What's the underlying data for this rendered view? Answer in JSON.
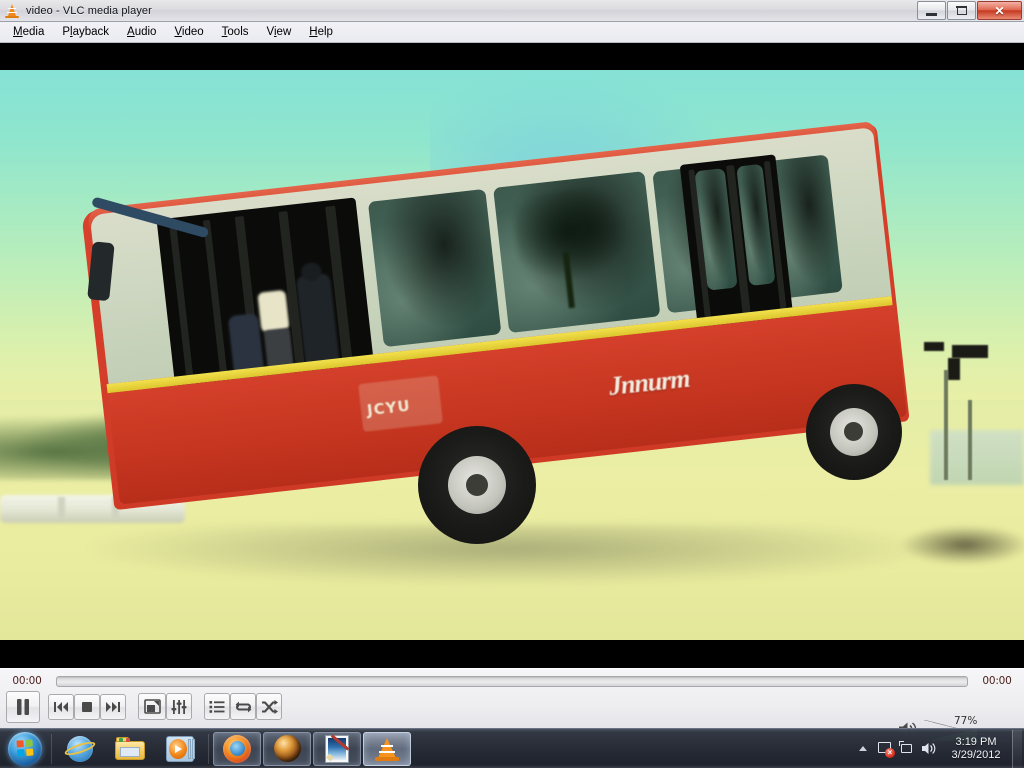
{
  "window": {
    "title": "video - VLC media player",
    "icon": "vlc-cone-icon",
    "minimize_label": "Minimize",
    "maximize_label": "Maximize",
    "close_label": "Close",
    "close_glyph": "✕"
  },
  "menubar": {
    "items": [
      {
        "label": "Media",
        "accel": "M"
      },
      {
        "label": "Playback",
        "accel": "l"
      },
      {
        "label": "Audio",
        "accel": "A"
      },
      {
        "label": "Video",
        "accel": "V"
      },
      {
        "label": "Tools",
        "accel": "T"
      },
      {
        "label": "View",
        "accel": "i"
      },
      {
        "label": "Help",
        "accel": "H"
      }
    ]
  },
  "video": {
    "description": "Red city bus with yellow stripe and open front door, passengers boarding, teal sky and pale yellow ground",
    "letterbox_color": "#000000",
    "sky_color": "#8fe4d0",
    "ground_color": "#e9eda2",
    "bus_color": "#d4402b",
    "stripe_color": "#f2e14c",
    "brand_text": "Jnnurm",
    "side_logo_text": "JCYU"
  },
  "controls": {
    "elapsed_time": "00:00",
    "total_time": "00:00",
    "seek_position_pct": 0,
    "buttons": [
      {
        "name": "play-pause-button",
        "label": "Pause"
      },
      {
        "name": "previous-button",
        "label": "Previous"
      },
      {
        "name": "stop-button",
        "label": "Stop"
      },
      {
        "name": "next-button",
        "label": "Next"
      },
      {
        "name": "fullscreen-button",
        "label": "Toggle fullscreen"
      },
      {
        "name": "extended-settings-button",
        "label": "Show extended settings"
      },
      {
        "name": "playlist-button",
        "label": "Show playlist"
      },
      {
        "name": "loop-button",
        "label": "Loop"
      },
      {
        "name": "shuffle-button",
        "label": "Random"
      }
    ],
    "volume": {
      "label": "77%",
      "value": 77,
      "icon": "speaker-icon",
      "fill_color": "#35bb24"
    }
  },
  "taskbar": {
    "start_label": "Start",
    "items": [
      {
        "name": "taskbar-internet-explorer",
        "label": "Internet Explorer",
        "state": "pinned"
      },
      {
        "name": "taskbar-windows-explorer",
        "label": "Windows Explorer",
        "state": "pinned"
      },
      {
        "name": "taskbar-media-player",
        "label": "Windows Media Player",
        "state": "pinned"
      },
      {
        "name": "taskbar-firefox",
        "label": "Mozilla Firefox",
        "state": "running"
      },
      {
        "name": "taskbar-browser",
        "label": "Web Browser",
        "state": "running"
      },
      {
        "name": "taskbar-paint",
        "label": "Paint",
        "state": "running"
      },
      {
        "name": "taskbar-vlc",
        "label": "VLC media player",
        "state": "active"
      }
    ],
    "tray": {
      "overflow_glyph": "▲",
      "icons": [
        {
          "name": "action-center-icon",
          "label": "Action Center"
        },
        {
          "name": "network-icon",
          "label": "Network"
        },
        {
          "name": "volume-icon",
          "label": "Volume"
        }
      ],
      "time": "3:19 PM",
      "date": "3/29/2012"
    }
  }
}
